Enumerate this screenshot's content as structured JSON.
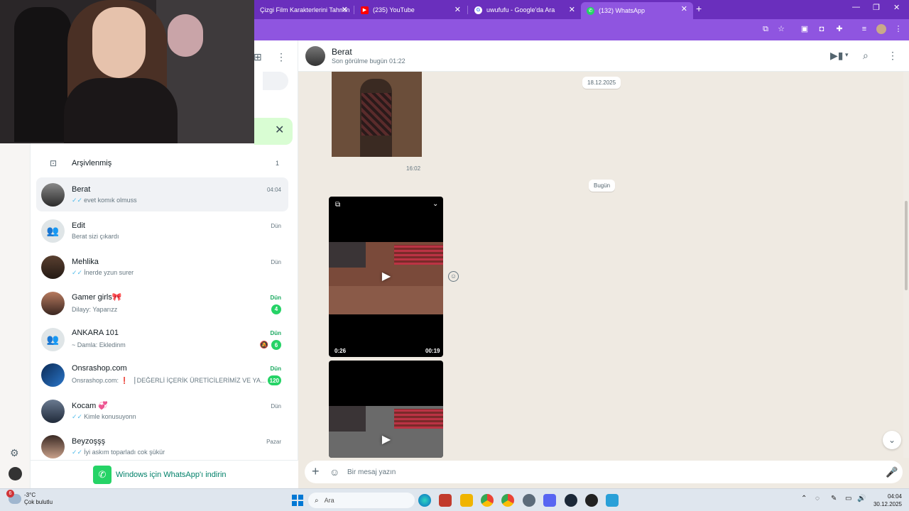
{
  "browser": {
    "tabs": [
      {
        "label": "Çizgi Film Karakterlerini Tahmin",
        "icon": "page-icon"
      },
      {
        "label": "(235) YouTube",
        "icon": "youtube-icon"
      },
      {
        "label": "uwufufu - Google'da Ara",
        "icon": "google-icon"
      },
      {
        "label": "(132) WhatsApp",
        "icon": "whatsapp-icon",
        "active": true
      }
    ],
    "accent": "#6a2fbd"
  },
  "sidebar": {
    "archived": {
      "label": "Arşivlenmiş",
      "count": "1"
    },
    "chats": [
      {
        "name": "Berat",
        "time": "04:04",
        "preview": "evet komık olmuss",
        "ticks": true,
        "selected": true
      },
      {
        "name": "Edit",
        "time": "Dün",
        "preview": "Berat sizi çıkardı",
        "group": true
      },
      {
        "name": "Mehlika",
        "time": "Dün",
        "preview": "İnerde yzun surer",
        "ticks": true
      },
      {
        "name": "Gamer girls🎀",
        "time": "Dün",
        "preview": "Dilayy: Yaparızz",
        "unread": "4"
      },
      {
        "name": "ANKARA 101",
        "time": "Dün",
        "preview": "~ Damla: Ekledinm",
        "unread": "6",
        "muted": true,
        "group": true
      },
      {
        "name": "Onsrashop.com",
        "time": "Dün",
        "preview": "Onsrashop.com: ❗ ▕ DEĞERLİ İÇERİK ÜRETİCİLERİMİZ VE YA...",
        "unread": "120"
      },
      {
        "name": "Kocam 💞",
        "time": "Dün",
        "preview": "Kimle konusuyonn",
        "ticks": true
      },
      {
        "name": "Beyzoşşş",
        "time": "Pazar",
        "preview": "İyi askım toparladı cok şükür",
        "ticks": true
      }
    ],
    "download_label": "Windows için WhatsApp'ı indirin"
  },
  "conversation": {
    "name": "Berat",
    "status": "Son görülme bugün 01:22",
    "date_old": "18.12.2025",
    "time_old": "16:02",
    "date_today": "Bugün",
    "video1": {
      "length": "0:26",
      "position": "00:19"
    },
    "composer_placeholder": "Bir mesaj yazın"
  },
  "taskbar": {
    "weather_temp": "-3°C",
    "weather_desc": "Çok bulutlu",
    "weather_badge": "6",
    "search_label": "Ara",
    "time": "04:04",
    "date": "30.12.2025"
  }
}
